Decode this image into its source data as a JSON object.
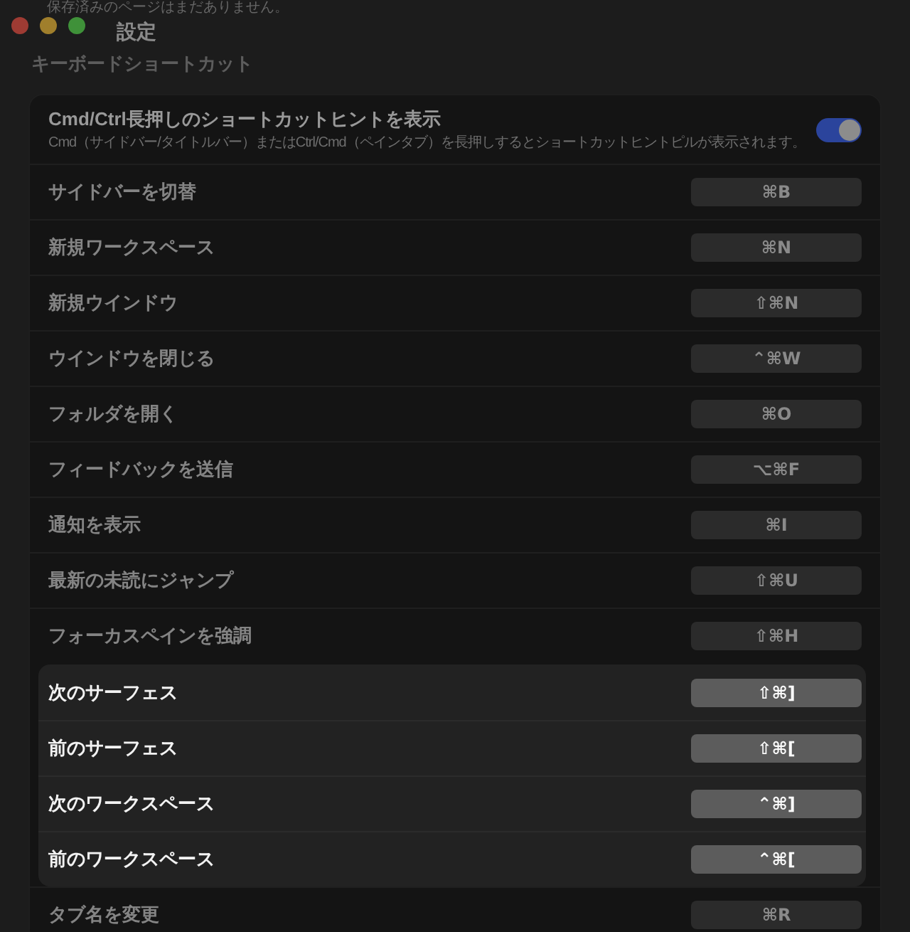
{
  "background_text": "保存済みのページはまだありません。",
  "window": {
    "title": "設定"
  },
  "section": {
    "heading": "キーボードショートカット"
  },
  "hint_setting": {
    "title": "Cmd/Ctrl長押しのショートカットヒントを表示",
    "description": "Cmd（サイドバー/タイトルバー）またはCtrl/Cmd（ペインタブ）を長押しするとショートカットヒントピルが表示されます。",
    "on": true
  },
  "shortcuts": [
    {
      "label": "サイドバーを切替",
      "keys": "⌘B",
      "highlighted": false
    },
    {
      "label": "新規ワークスペース",
      "keys": "⌘N",
      "highlighted": false
    },
    {
      "label": "新規ウインドウ",
      "keys": "⇧⌘N",
      "highlighted": false
    },
    {
      "label": "ウインドウを閉じる",
      "keys": "⌃⌘W",
      "highlighted": false
    },
    {
      "label": "フォルダを開く",
      "keys": "⌘O",
      "highlighted": false
    },
    {
      "label": "フィードバックを送信",
      "keys": "⌥⌘F",
      "highlighted": false
    },
    {
      "label": "通知を表示",
      "keys": "⌘I",
      "highlighted": false
    },
    {
      "label": "最新の未読にジャンプ",
      "keys": "⇧⌘U",
      "highlighted": false
    },
    {
      "label": "フォーカスペインを強調",
      "keys": "⇧⌘H",
      "highlighted": false
    },
    {
      "label": "次のサーフェス",
      "keys": "⇧⌘]",
      "highlighted": true
    },
    {
      "label": "前のサーフェス",
      "keys": "⇧⌘[",
      "highlighted": true
    },
    {
      "label": "次のワークスペース",
      "keys": "⌃⌘]",
      "highlighted": true
    },
    {
      "label": "前のワークスペース",
      "keys": "⌃⌘[",
      "highlighted": true
    },
    {
      "label": "タブ名を変更",
      "keys": "⌘R",
      "highlighted": false
    }
  ]
}
